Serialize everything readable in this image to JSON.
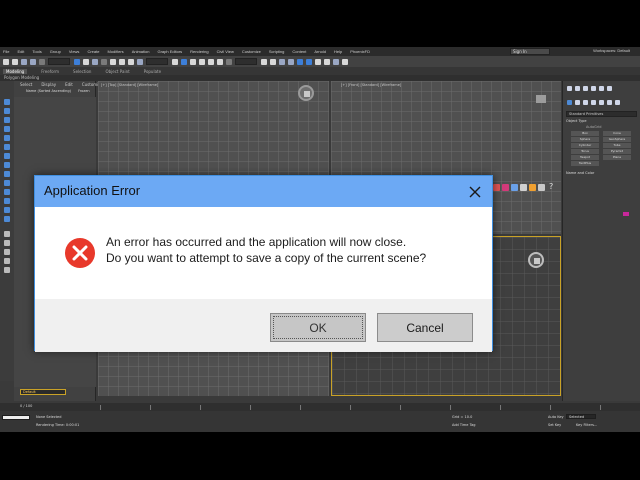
{
  "dialog": {
    "title": "Application Error",
    "message_line1": "An error has occurred and the application will now close.",
    "message_line2": "Do you want to attempt to save a copy of the current scene?",
    "ok_label": "OK",
    "cancel_label": "Cancel",
    "icons": {
      "error": "error-circle-x-icon",
      "close": "close-icon"
    },
    "colors": {
      "titlebar": "#6ca9f4",
      "error_red": "#e8392b",
      "border": "#3f8fe0"
    }
  },
  "app": {
    "menu": [
      "File",
      "Edit",
      "Tools",
      "Group",
      "Views",
      "Create",
      "Modifiers",
      "Animation",
      "Graph Editors",
      "Rendering",
      "Civil View",
      "Customize",
      "Scripting",
      "Content",
      "Arnold",
      "Help",
      "PhoenixFD"
    ],
    "menu_right_value": "Sign In",
    "workspace_label": "Workspaces: Default",
    "ribbon_tabs": [
      "Modeling",
      "Freeform",
      "Selection",
      "Object Paint",
      "Populate"
    ],
    "sub_ribbon": "Polygon Modeling",
    "explorer": {
      "tabs": [
        "Select",
        "Display",
        "Edit",
        "Customize"
      ],
      "header": "Name (Sorted Ascending)",
      "header_right": "Frozen"
    },
    "viewports": {
      "top_left": "[+] [Top] [Standard] [Wireframe]",
      "top_right": "[+] [Front] [Standard] [Wireframe]"
    },
    "command_panel": {
      "dropdown": "Standard Primitives",
      "section_object_type": "Object Type",
      "autogrid": "AutoGrid",
      "primitives": [
        "Box",
        "Cone",
        "Sphere",
        "GeoSphere",
        "Cylinder",
        "Tube",
        "Torus",
        "Pyramid",
        "Teapot",
        "Plane",
        "TextPlus"
      ],
      "section_name_color": "Name and Color"
    },
    "layer_default": "Default",
    "status": {
      "frame": "0 / 100",
      "selection": "None Selected",
      "render_time": "Rendering Time: 0:00:01",
      "grid": "Grid = 10.0",
      "auto_key": "Auto Key",
      "selected": "Selected",
      "set_key": "Set Key",
      "key_filters": "Key Filters...",
      "add_time_tag": "Add Time Tag"
    }
  }
}
